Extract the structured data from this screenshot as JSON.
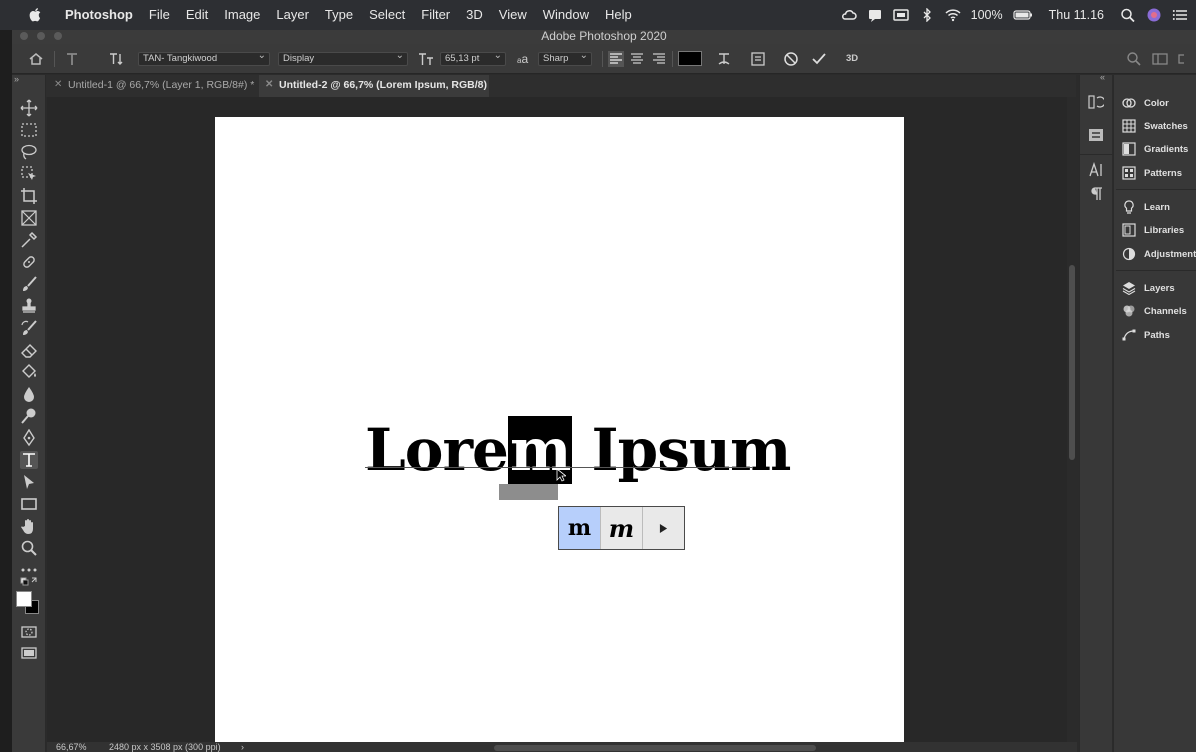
{
  "menubar": {
    "app": "Photoshop",
    "items": [
      "File",
      "Edit",
      "Image",
      "Layer",
      "Type",
      "Select",
      "Filter",
      "3D",
      "View",
      "Window",
      "Help"
    ],
    "battery": "100%",
    "clock": "Thu 11.16"
  },
  "window": {
    "title": "Adobe Photoshop 2020"
  },
  "options": {
    "font_family": "TAN- Tangkiwood",
    "font_style": "Display",
    "font_size": "65,13 pt",
    "aa_label": "a",
    "antialias": "Sharp",
    "threed": "3D",
    "text_color": "#000000"
  },
  "tabs": [
    {
      "label": "Untitled-1 @ 66,7% (Layer 1, RGB/8#) *",
      "active": false
    },
    {
      "label": "Untitled-2 @ 66,7% (Lorem Ipsum, RGB/8) *",
      "active": true
    }
  ],
  "canvas": {
    "text_before": "Lore",
    "text_selected": "m",
    "text_after": " Ipsum"
  },
  "glyph_alternates": {
    "options": [
      "m",
      "m"
    ],
    "selected_index": 0
  },
  "statusbar": {
    "zoom": "66,67%",
    "doc_size": "2480 px x 3508 px (300 ppi)",
    "arrow": "›"
  },
  "panels": [
    {
      "label": "Color",
      "icon": "color-wheel-icon"
    },
    {
      "label": "Swatches",
      "icon": "grid-icon"
    },
    {
      "label": "Gradients",
      "icon": "gradient-icon"
    },
    {
      "label": "Patterns",
      "icon": "pattern-icon"
    },
    {
      "label": "Learn",
      "icon": "bulb-icon"
    },
    {
      "label": "Libraries",
      "icon": "libraries-icon"
    },
    {
      "label": "Adjustments",
      "icon": "adjust-icon"
    },
    {
      "label": "Layers",
      "icon": "layers-icon"
    },
    {
      "label": "Channels",
      "icon": "channels-icon"
    },
    {
      "label": "Paths",
      "icon": "paths-icon"
    }
  ],
  "colors": {
    "accent": "#b7cffb",
    "canvas": "#ffffff",
    "ui_dark": "#2b2b2b"
  }
}
